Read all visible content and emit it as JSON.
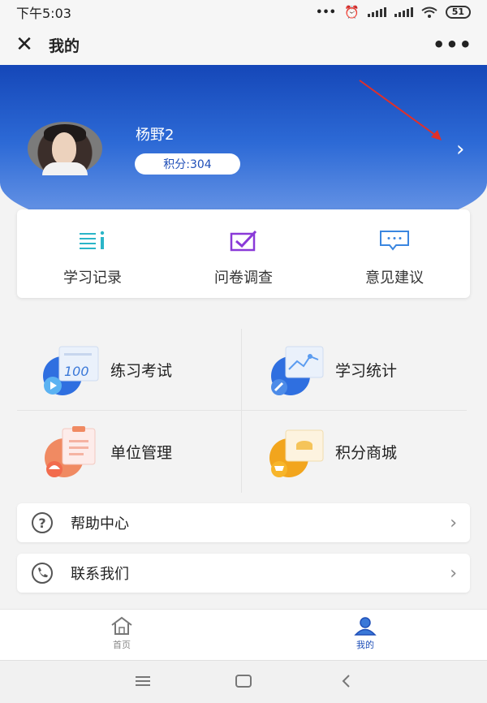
{
  "status_bar": {
    "time": "下午5:03",
    "battery": "51"
  },
  "titlebar": {
    "title": "我的"
  },
  "profile": {
    "name": "杨野2",
    "points_label": "积分:304"
  },
  "quick_actions": [
    {
      "label": "学习记录",
      "icon": "list-icon"
    },
    {
      "label": "问卷调查",
      "icon": "checkbox-icon"
    },
    {
      "label": "意见建议",
      "icon": "chat-bubble-icon"
    }
  ],
  "features": [
    {
      "label": "练习考试",
      "icon": "exam-paper-icon"
    },
    {
      "label": "学习统计",
      "icon": "statistics-icon"
    },
    {
      "label": "单位管理",
      "icon": "clipboard-icon"
    },
    {
      "label": "积分商城",
      "icon": "shopping-cart-icon"
    }
  ],
  "list_rows": [
    {
      "label": "帮助中心",
      "icon": "question-icon"
    },
    {
      "label": "联系我们",
      "icon": "phone-icon"
    }
  ],
  "tabs": [
    {
      "label": "首页",
      "icon": "home-icon"
    },
    {
      "label": "我的",
      "icon": "user-icon"
    }
  ],
  "colors": {
    "accent": "#1f4fb8",
    "purple": "#8a3ad8",
    "teal": "#2bb5c8"
  }
}
